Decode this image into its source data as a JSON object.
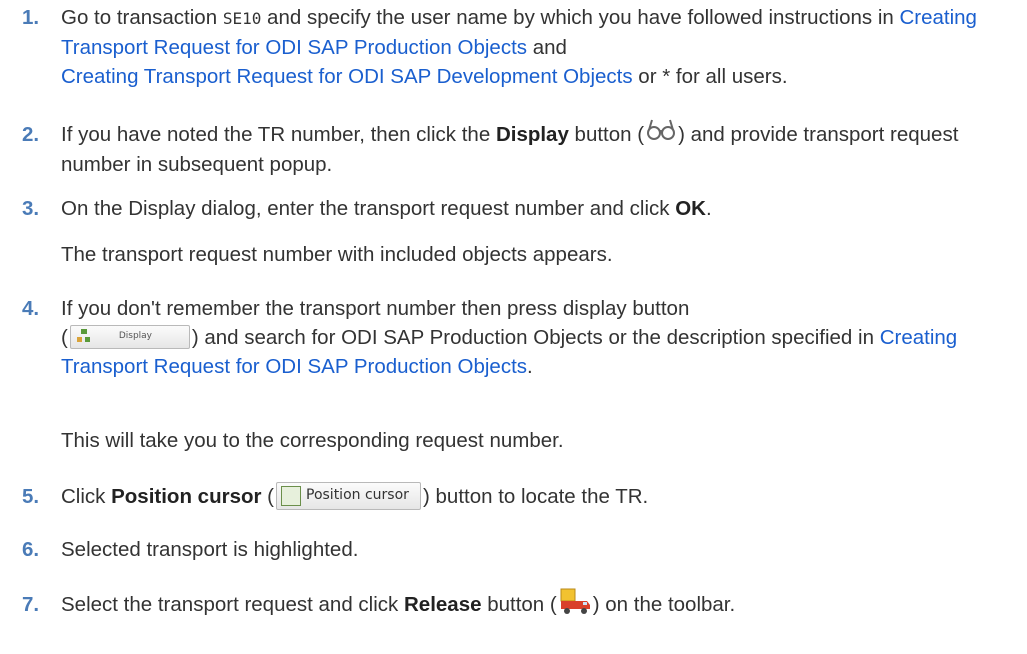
{
  "steps": [
    {
      "num": "1.",
      "t1": "Go to transaction ",
      "code": "SE10",
      "t2": " and specify the user name by which you have followed instructions in ",
      "link1": "Creating Transport Request for ODI SAP Production Objects",
      "t3": " and ",
      "link2": "Creating Transport Request for ODI SAP Development Objects",
      "t4": " or * for all users."
    },
    {
      "num": "2.",
      "t1": "If you have noted the TR number, then click the ",
      "bold": "Display",
      "t2": " button (",
      "icon": "display-glasses-icon",
      "t3": ") and provide transport request number in subsequent popup."
    },
    {
      "num": "3.",
      "t1": "On the Display dialog, enter the transport request number and click ",
      "bold": "OK",
      "t2": ".",
      "sub": "The transport request number with included objects appears."
    },
    {
      "num": "4.",
      "t1": "If you don't remember the transport number then press display button",
      "t2": "(",
      "button_label": "Display",
      "t3": ") and search for ODI SAP Production Objects or the description specified in ",
      "link": "Creating Transport Request for ODI SAP Production Objects",
      "t4": ".",
      "sub": "This will take you to the corresponding request number."
    },
    {
      "num": "5.",
      "t1": "Click ",
      "bold": "Position cursor",
      "t2": " (",
      "button_label": "Position cursor",
      "t3": ") button to locate the TR."
    },
    {
      "num": "6.",
      "t1": "Selected transport is highlighted."
    },
    {
      "num": "7.",
      "t1": "Select the transport request and click ",
      "bold": "Release",
      "t2": " button (",
      "icon": "release-truck-icon",
      "t3": ") on the toolbar."
    }
  ],
  "colors": {
    "number": "#4a7bb7",
    "link": "#1a5fcf",
    "text": "#333333"
  }
}
